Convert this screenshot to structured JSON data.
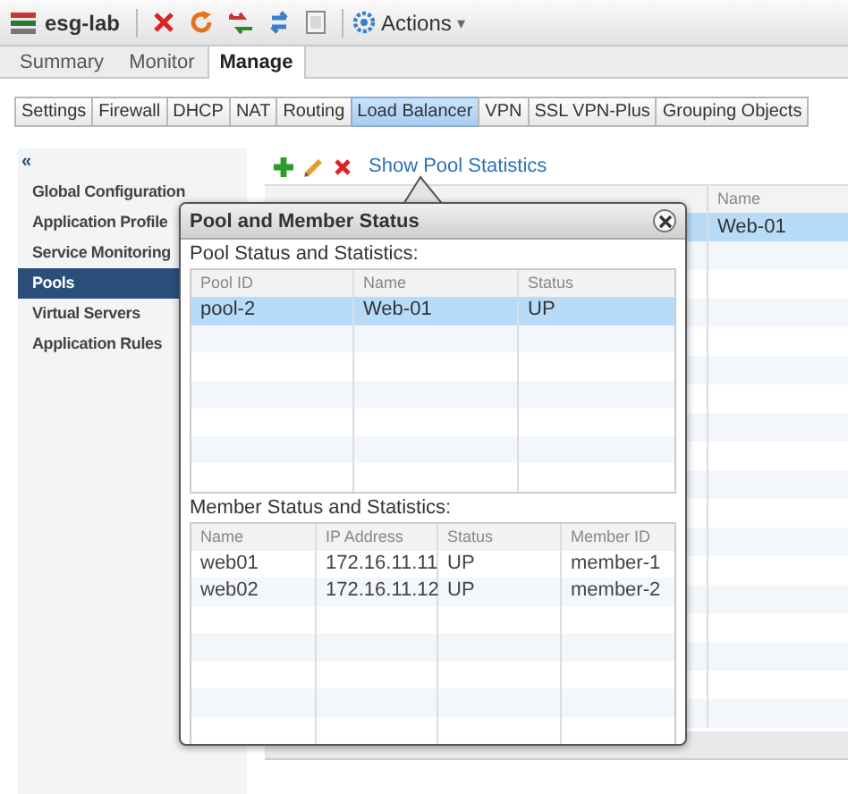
{
  "toolbar": {
    "title": "esg-lab",
    "actions_label": "Actions",
    "actions_caret": "▾"
  },
  "tabs": [
    {
      "label": "Summary",
      "selected": false
    },
    {
      "label": "Monitor",
      "selected": false
    },
    {
      "label": "Manage",
      "selected": true
    }
  ],
  "subtabs": [
    {
      "label": "Settings",
      "selected": false
    },
    {
      "label": "Firewall",
      "selected": false
    },
    {
      "label": "DHCP",
      "selected": false
    },
    {
      "label": "NAT",
      "selected": false
    },
    {
      "label": "Routing",
      "selected": false
    },
    {
      "label": "Load Balancer",
      "selected": true
    },
    {
      "label": "VPN",
      "selected": false
    },
    {
      "label": "SSL VPN-Plus",
      "selected": false
    },
    {
      "label": "Grouping Objects",
      "selected": false
    }
  ],
  "sidebar": {
    "collapse": "«",
    "items": [
      {
        "label": "Global Configuration",
        "selected": false
      },
      {
        "label": "Application Profile",
        "selected": false
      },
      {
        "label": "Service Monitoring",
        "selected": false
      },
      {
        "label": "Pools",
        "selected": true
      },
      {
        "label": "Virtual Servers",
        "selected": false
      },
      {
        "label": "Application Rules",
        "selected": false
      }
    ]
  },
  "main": {
    "link": "Show Pool Statistics",
    "table": {
      "columns": [
        "Name"
      ],
      "rows": [
        {
          "cells": [
            "Web-01"
          ],
          "selected": true
        }
      ]
    }
  },
  "dialog": {
    "title": "Pool and Member Status",
    "sections": [
      {
        "label": "Pool Status and Statistics:",
        "columns": [
          "Pool ID",
          "Name",
          "Status"
        ],
        "rows": [
          {
            "cells": [
              "pool-2",
              "Web-01",
              "UP"
            ],
            "selected": true
          }
        ]
      },
      {
        "label": "Member Status and Statistics:",
        "columns": [
          "Name",
          "IP Address",
          "Status",
          "Member ID"
        ],
        "rows": [
          {
            "cells": [
              "web01",
              "172.16.11.11",
              "UP",
              "member-1"
            ],
            "selected": false
          },
          {
            "cells": [
              "web02",
              "172.16.11.12",
              "UP",
              "member-2"
            ],
            "selected": false
          }
        ]
      }
    ]
  }
}
